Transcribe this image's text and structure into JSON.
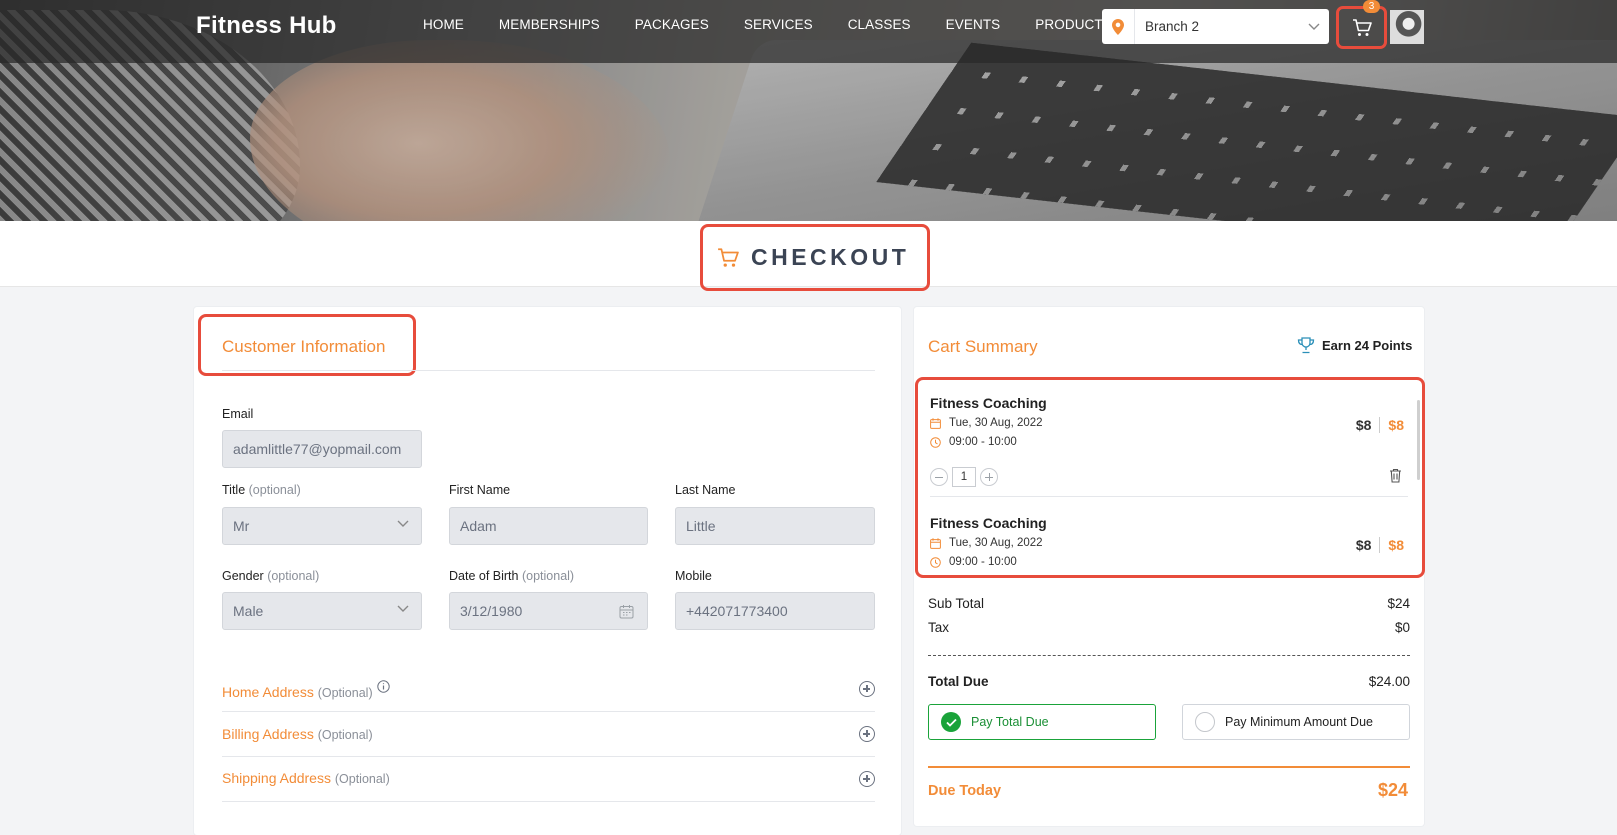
{
  "header": {
    "brand": "Fitness Hub",
    "nav": [
      "HOME",
      "MEMBERSHIPS",
      "PACKAGES",
      "SERVICES",
      "CLASSES",
      "EVENTS",
      "PRODUCTS"
    ],
    "branch": "Branch 2",
    "cart_count": "3"
  },
  "page_title": "CHECKOUT",
  "customer": {
    "title": "Customer Information",
    "email_label": "Email",
    "email": "adamlittle77@yopmail.com",
    "title_label": "Title",
    "optional": "(optional)",
    "title_value": "Mr",
    "first_name_label": "First Name",
    "first_name": "Adam",
    "last_name_label": "Last Name",
    "last_name": "Little",
    "gender_label": "Gender",
    "gender": "Male",
    "dob_label": "Date of Birth",
    "dob": "3/12/1980",
    "mobile_label": "Mobile",
    "mobile": "+442071773400",
    "sections": [
      {
        "label": "Home Address",
        "optional": "(Optional)"
      },
      {
        "label": "Billing Address",
        "optional": "(Optional)"
      },
      {
        "label": "Shipping Address",
        "optional": "(Optional)"
      }
    ]
  },
  "cart": {
    "title": "Cart Summary",
    "earn": "Earn 24 Points",
    "items": [
      {
        "name": "Fitness Coaching",
        "date": "Tue, 30 Aug, 2022",
        "time": "09:00 - 10:00",
        "qty": "1",
        "price": "$8",
        "total": "$8"
      },
      {
        "name": "Fitness Coaching",
        "date": "Tue, 30 Aug, 2022",
        "time": "09:00 - 10:00",
        "price": "$8",
        "total": "$8"
      }
    ],
    "sub_total_label": "Sub Total",
    "sub_total": "$24",
    "tax_label": "Tax",
    "tax": "$0",
    "total_due_label": "Total Due",
    "total_due": "$24.00",
    "pay_total": "Pay Total Due",
    "pay_min": "Pay Minimum Amount Due",
    "due_today_label": "Due Today",
    "due_today": "$24"
  },
  "colors": {
    "accent": "#f28c38",
    "highlight": "#e74c3c",
    "success": "#1aa33a"
  }
}
